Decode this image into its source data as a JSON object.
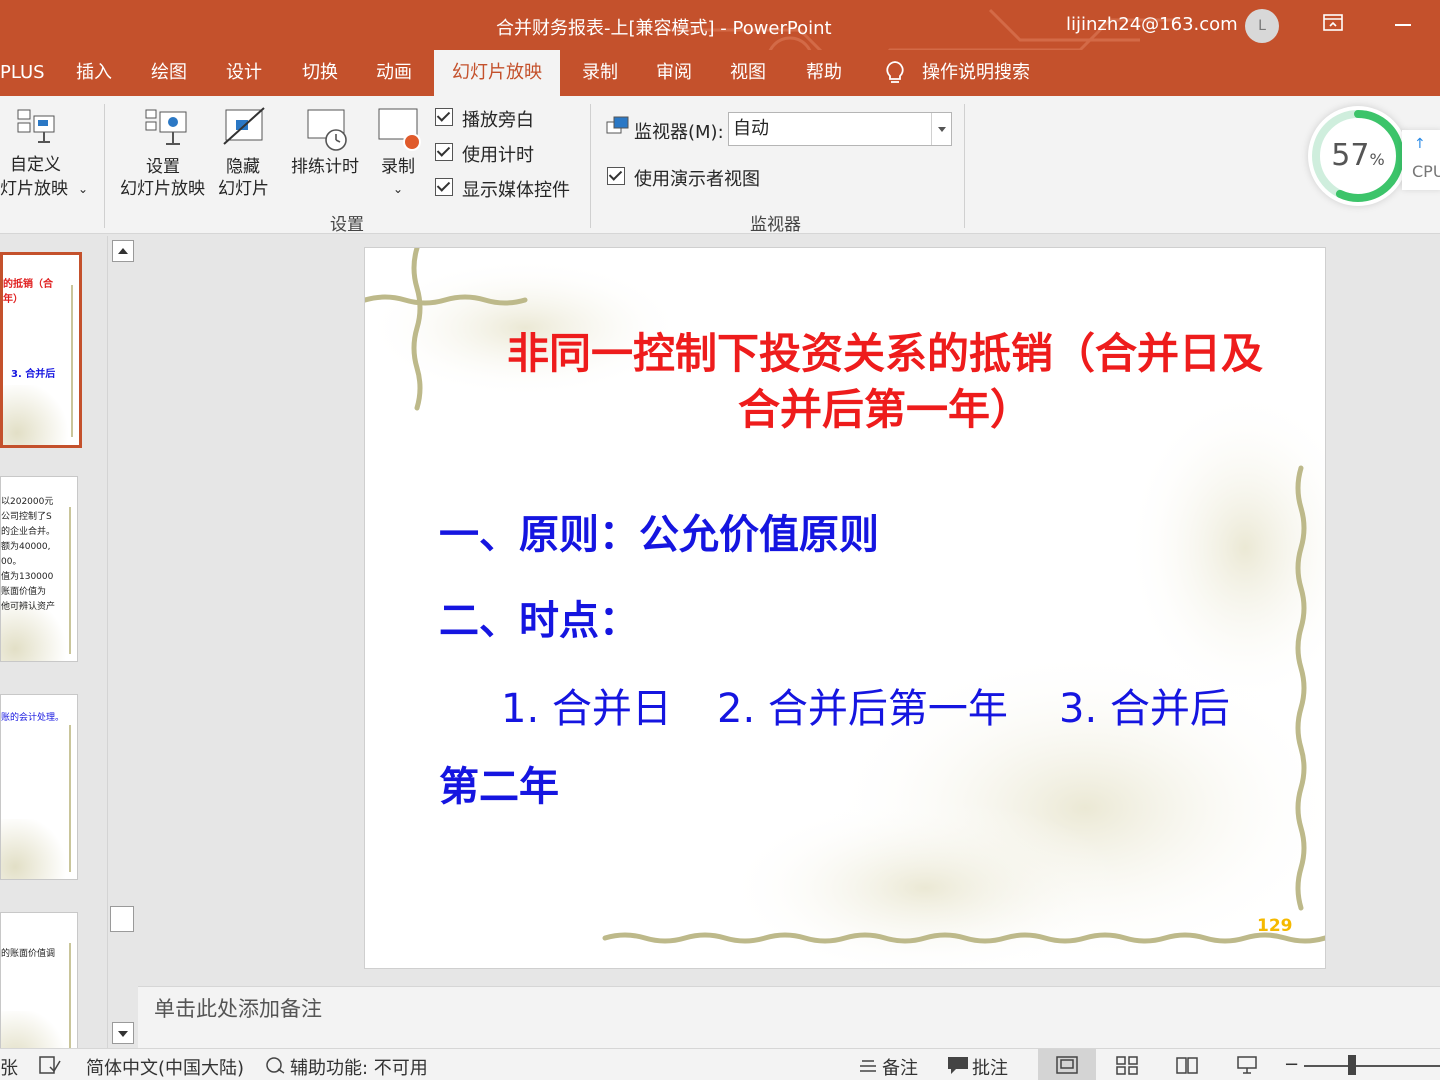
{
  "window": {
    "title": "合并财务报表-上[兼容模式]  -  PowerPoint",
    "account": "lijinzh24@163.com",
    "avatar_initial": "L"
  },
  "tabs": [
    {
      "label": "PLUS"
    },
    {
      "label": "插入"
    },
    {
      "label": "绘图"
    },
    {
      "label": "设计"
    },
    {
      "label": "切换"
    },
    {
      "label": "动画"
    },
    {
      "label": "幻灯片放映",
      "active": true
    },
    {
      "label": "录制"
    },
    {
      "label": "审阅"
    },
    {
      "label": "视图"
    },
    {
      "label": "帮助"
    },
    {
      "label": "操作说明搜索"
    }
  ],
  "ribbon": {
    "custom_show_line1": "自定义",
    "custom_show_line2": "灯片放映",
    "setup_line1": "设置",
    "setup_line2": "幻灯片放映",
    "hide_line1": "隐藏",
    "hide_line2": "幻灯片",
    "rehearse": "排练计时",
    "record": "录制",
    "chk_narration": "播放旁白",
    "chk_timings": "使用计时",
    "chk_media": "显示媒体控件",
    "group_setup": "设置",
    "monitor_label": "监视器(M):",
    "monitor_value": "自动",
    "chk_presenter": "使用演示者视图",
    "group_monitor": "监视器"
  },
  "cpu": {
    "value": "57",
    "unit": "%",
    "label": "CPU",
    "percent": 57
  },
  "thumbnails": [
    {
      "lines": [
        "的抵销（合",
        "年）",
        "3. 合并后"
      ]
    },
    {
      "lines": [
        "以202000元",
        "公司控制了S",
        "的企业合并。",
        "额为40000,",
        "00。",
        "值为130000",
        "账面价值为",
        "他可辨认资产"
      ]
    },
    {
      "lines": [
        "账的会计处理。"
      ]
    },
    {
      "lines": [
        "的账面价值调"
      ]
    }
  ],
  "slide": {
    "title": "非同一控制下投资关系的抵销（合并日及合并后第一年）",
    "line1": "一、原则：公允价值原则",
    "line2": "二、时点：",
    "line3a": "1. 合并日",
    "line3b": "2. 合并后第一年",
    "line3c": "3. 合并后",
    "line4": "第二年",
    "number": "129"
  },
  "notes": {
    "placeholder": "单击此处添加备注"
  },
  "status": {
    "left_cut": "张",
    "language": "简体中文(中国大陆)",
    "accessibility": "辅助功能: 不可用",
    "notes_btn": "备注",
    "comments_btn": "批注",
    "zoom_minus": "−"
  },
  "colors": {
    "accent": "#c4512c",
    "title_red": "#ee1c1c",
    "body_blue": "#1515e0",
    "slide_num": "#f5b900",
    "cpu_green": "#3cc46a"
  }
}
